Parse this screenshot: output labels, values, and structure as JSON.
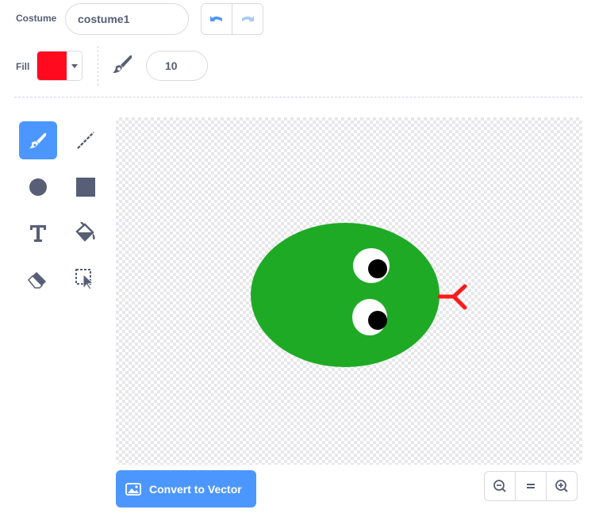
{
  "costume": {
    "label": "Costume",
    "name": "costume1"
  },
  "fill": {
    "label": "Fill",
    "color": "#ff0a1e"
  },
  "brush": {
    "size": "10"
  },
  "tools": [
    {
      "name": "brush",
      "icon": "brush-icon",
      "active": true
    },
    {
      "name": "line",
      "icon": "line-icon"
    },
    {
      "name": "circle",
      "icon": "circle-icon"
    },
    {
      "name": "rectangle",
      "icon": "rectangle-icon"
    },
    {
      "name": "text",
      "icon": "text-icon"
    },
    {
      "name": "fill",
      "icon": "paint-bucket-icon"
    },
    {
      "name": "eraser",
      "icon": "eraser-icon"
    },
    {
      "name": "select",
      "icon": "select-icon"
    }
  ],
  "drawing": {
    "head_color": "#1faa26",
    "eye_white": "#ffffff",
    "pupil": "#000000",
    "tongue_color": "#ff1a1a"
  },
  "convert_button": {
    "label": "Convert to Vector"
  },
  "accent": "#4c97ff"
}
